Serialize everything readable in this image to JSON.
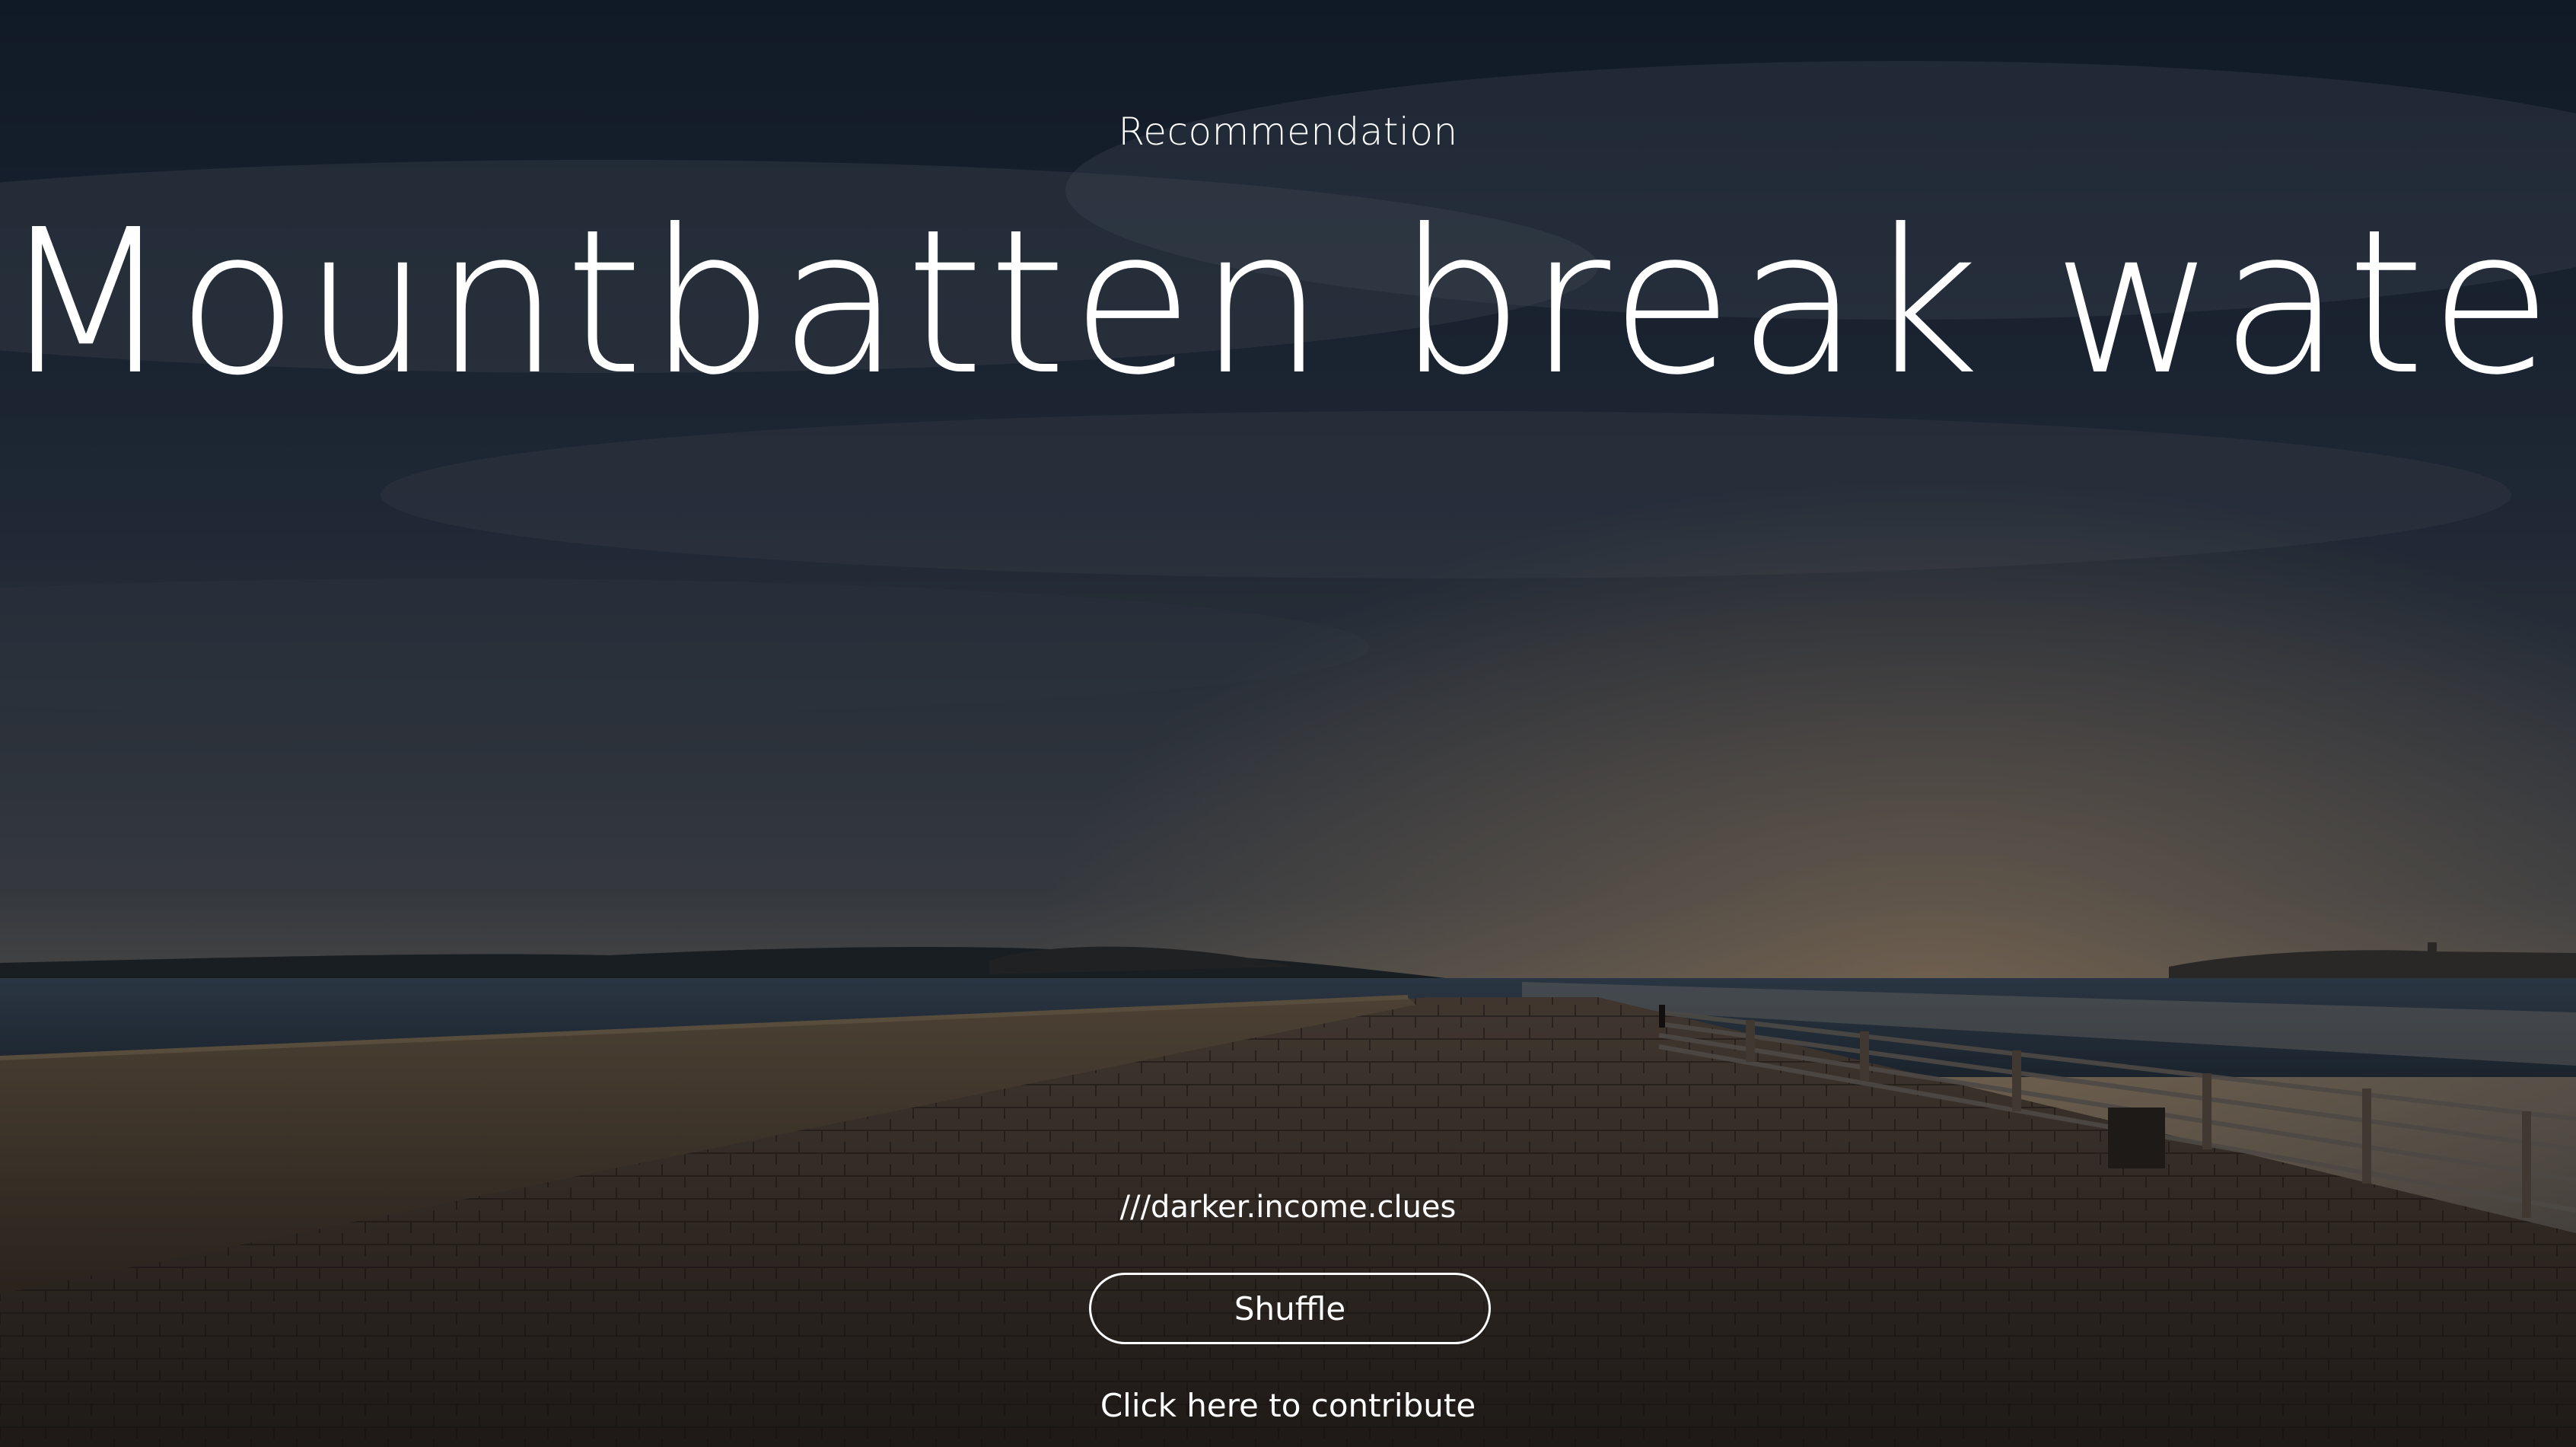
{
  "page": {
    "eyebrow": "Recommendation",
    "headline": "Mountbatten break water",
    "address": "///darker.income.clues",
    "shuffle_label": "Shuffle",
    "contribute_label": "Click here to contribute"
  },
  "background": {
    "description_icon": "seafront-pier-at-dusk-photo",
    "colors": {
      "sky_top": "#1c2a3c",
      "sky_mid": "#3a4656",
      "horizon_glow": "#8a7b6c",
      "sea": "#2f3f50",
      "pier": "#3d3530"
    }
  }
}
